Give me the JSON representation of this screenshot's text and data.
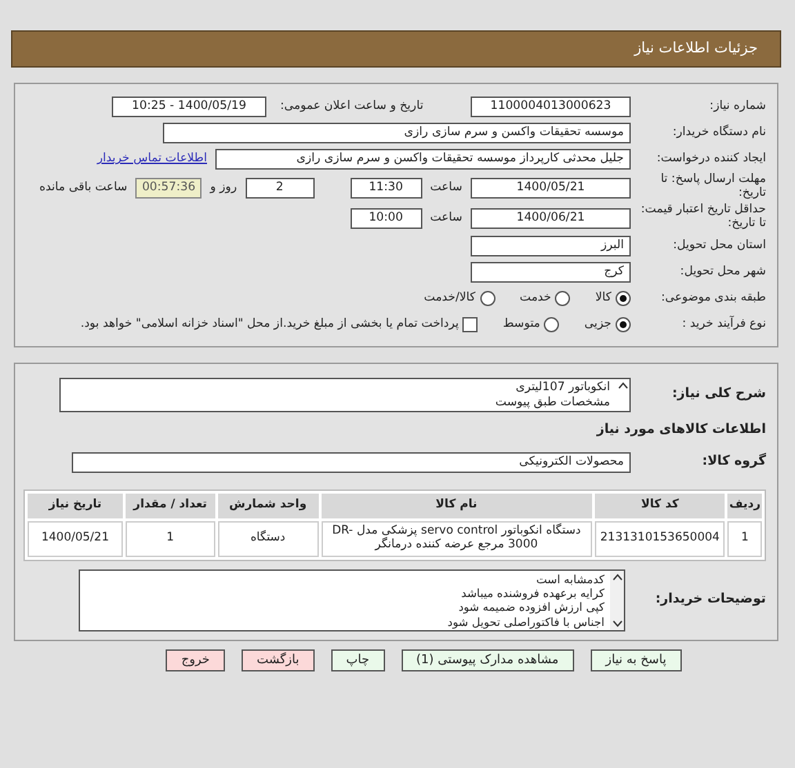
{
  "header": {
    "title": "جزئیات اطلاعات نیاز"
  },
  "need_info": {
    "need_number": {
      "label": "شماره نیاز:",
      "value": "1100004013000623"
    },
    "announce": {
      "label": "تاریخ و ساعت اعلان عمومی:",
      "value": "1400/05/19 - 10:25"
    },
    "buyer_org": {
      "label": "نام دستگاه خریدار:",
      "value": "موسسه تحقیقات واکسن و سرم سازی رازی"
    },
    "requester": {
      "label": "ایجاد کننده درخواست:",
      "value": "جلیل محدثی کارپرداز موسسه تحقیقات واکسن و سرم سازی رازی",
      "link": "اطلاعات تماس خریدار"
    },
    "deadline": {
      "label": "مهلت ارسال پاسخ: تا تاریخ:",
      "date": "1400/05/21",
      "time_label": "ساعت",
      "time": "11:30",
      "days": "2",
      "days_label": "روز و",
      "remaining": "00:57:36",
      "remaining_label": "ساعت باقی مانده"
    },
    "validity": {
      "label": "حداقل تاریخ اعتبار قیمت: تا تاریخ:",
      "date": "1400/06/21",
      "time_label": "ساعت",
      "time": "10:00"
    },
    "province": {
      "label": "استان محل تحویل:",
      "value": "البرز"
    },
    "city": {
      "label": "شهر محل تحویل:",
      "value": "کرج"
    },
    "category": {
      "label": "طبقه بندی موضوعی:",
      "options": [
        {
          "label": "کالا",
          "selected": true
        },
        {
          "label": "خدمت",
          "selected": false
        },
        {
          "label": "کالا/خدمت",
          "selected": false
        }
      ]
    },
    "process": {
      "label": "نوع فرآیند خرید :",
      "options": [
        {
          "label": "جزیی",
          "selected": true
        },
        {
          "label": "متوسط",
          "selected": false
        }
      ],
      "treasury": {
        "label": "پرداخت تمام یا بخشی از مبلغ خرید.از محل \"اسناد خزانه اسلامی\" خواهد بود.",
        "checked": false
      }
    }
  },
  "goods": {
    "description": {
      "label": "شرح کلی نیاز:",
      "lines": [
        "انکوباتور 107لیتری",
        "مشخصات طبق پیوست"
      ]
    },
    "heading": "اطلاعات کالاهای مورد نیاز",
    "group": {
      "label": "گروه کالا:",
      "value": "محصولات الکترونیکی"
    },
    "table": {
      "columns": [
        "ردیف",
        "کد کالا",
        "نام کالا",
        "واحد شمارش",
        "تعداد / مقدار",
        "تاریخ نیاز"
      ],
      "rows": [
        [
          "1",
          "2131310153650004",
          "دستگاه انکوباتور servo control پزشکی مدل DR-3000 مرجع عرضه کننده درمانگر",
          "دستگاه",
          "1",
          "1400/05/21"
        ]
      ]
    },
    "buyer_notes": {
      "label": "توضیحات خریدار:",
      "lines": [
        "کدمشابه است",
        "کرایه برعهده فروشنده میباشد",
        "کپی ارزش افزوده ضمیمه شود",
        "اجناس با فاکتوراصلی تحویل شود"
      ]
    }
  },
  "buttons": [
    {
      "label": "پاسخ به نیاز",
      "kind": "primary"
    },
    {
      "label": "مشاهده مدارک پیوستی (1)",
      "kind": "primary"
    },
    {
      "label": "چاپ",
      "kind": "primary"
    },
    {
      "label": "بازگشت",
      "kind": "danger"
    },
    {
      "label": "خروج",
      "kind": "danger"
    }
  ]
}
